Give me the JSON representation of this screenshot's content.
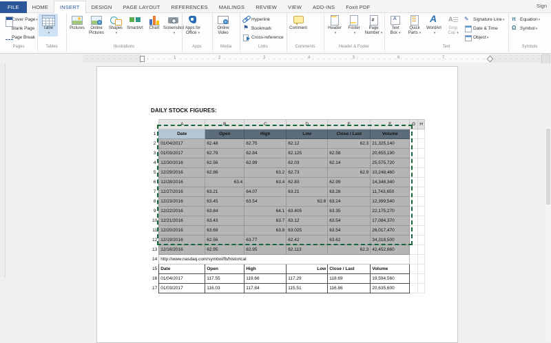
{
  "ribbon": {
    "tabs": [
      "FILE",
      "HOME",
      "INSERT",
      "DESIGN",
      "PAGE LAYOUT",
      "REFERENCES",
      "MAILINGS",
      "REVIEW",
      "VIEW",
      "ADD-INS",
      "Foxit PDF"
    ],
    "active_tab": "INSERT",
    "sign_label": "Sign",
    "groups": [
      {
        "label": "Pages",
        "items": [
          {
            "l1": "Cover Page",
            "arrow": true,
            "icon": "cover-page-icon",
            "small": true
          },
          {
            "l1": "Blank Page",
            "icon": "blank-page-icon",
            "small": true
          },
          {
            "l1": "Page Break",
            "icon": "page-break-icon",
            "small": true
          }
        ]
      },
      {
        "label": "Tables",
        "items": [
          {
            "l1": "Table",
            "arrow": true,
            "icon": "table-icon",
            "highlight": true
          }
        ]
      },
      {
        "label": "Illustrations",
        "items": [
          {
            "l1": "Pictures",
            "icon": "pictures-icon"
          },
          {
            "l1": "Online",
            "l2": "Pictures",
            "icon": "online-pictures-icon"
          },
          {
            "l1": "Shapes",
            "arrow": true,
            "icon": "shapes-icon"
          },
          {
            "l1": "SmartArt",
            "icon": "smartart-icon"
          },
          {
            "l1": "Chart",
            "icon": "chart-icon"
          },
          {
            "l1": "Screenshot",
            "arrow": true,
            "icon": "screenshot-icon"
          }
        ]
      },
      {
        "label": "Apps",
        "items": [
          {
            "l1": "Apps for",
            "l2": "Office",
            "arrow": true,
            "icon": "apps-for-office-icon"
          }
        ]
      },
      {
        "label": "Media",
        "items": [
          {
            "l1": "Online",
            "l2": "Video",
            "icon": "online-video-icon"
          }
        ]
      },
      {
        "label": "Links",
        "items": [
          {
            "l1": "Hyperlink",
            "icon": "hyperlink-icon",
            "small": true
          },
          {
            "l1": "Bookmark",
            "icon": "bookmark-icon",
            "small": true
          },
          {
            "l1": "Cross-reference",
            "icon": "cross-reference-icon",
            "small": true
          }
        ]
      },
      {
        "label": "Comments",
        "items": [
          {
            "l1": "Comment",
            "icon": "comment-icon"
          }
        ]
      },
      {
        "label": "Header & Footer",
        "items": [
          {
            "l1": "Header",
            "arrow": true,
            "icon": "header-icon"
          },
          {
            "l1": "Footer",
            "arrow": true,
            "icon": "footer-icon"
          },
          {
            "l1": "Page",
            "l2": "Number",
            "arrow": true,
            "icon": "page-number-icon"
          }
        ]
      },
      {
        "label": "Text",
        "items": [
          {
            "l1": "Text",
            "l2": "Box",
            "arrow": true,
            "icon": "text-box-icon"
          },
          {
            "l1": "Quick",
            "l2": "Parts",
            "arrow": true,
            "icon": "quick-parts-icon"
          },
          {
            "l1": "WordArt",
            "arrow": true,
            "icon": "wordart-icon"
          },
          {
            "l1": "Drop",
            "l2": "Cap",
            "arrow": true,
            "icon": "drop-cap-icon",
            "disabled": true
          },
          {
            "l1": "Signature Line",
            "arrow": true,
            "icon": "signature-line-icon",
            "small": true
          },
          {
            "l1": "Date & Time",
            "icon": "date-time-icon",
            "small": true
          },
          {
            "l1": "Object",
            "arrow": true,
            "icon": "object-icon",
            "small": true
          }
        ]
      },
      {
        "label": "Symbols",
        "items": [
          {
            "l1": "Equation",
            "arrow": true,
            "icon": "equation-icon",
            "small": true
          },
          {
            "l1": "Symbol",
            "arrow": true,
            "icon": "symbol-icon",
            "small": true
          }
        ]
      }
    ]
  },
  "ruler": {
    "numbers": [
      "1",
      "2",
      "3",
      "4",
      "5",
      "6",
      "7"
    ]
  },
  "colors": {
    "accent": "#2b579a",
    "selection_dash": "#17663a",
    "sheet_header_fill": "#5d6c7b",
    "active_cell_fill": "#b4c6d4",
    "selected_cell_fill": "#b5b5b5"
  },
  "document": {
    "title": "DAILY STOCK FIGURES:",
    "spreadsheet": {
      "column_letters": [
        "A",
        "B",
        "C",
        "D",
        "E",
        "F",
        "G",
        "H"
      ],
      "rows": [
        {
          "n": "1",
          "type": "h1",
          "cells": [
            "Date",
            "Open",
            "High",
            "Low",
            "Close / Last",
            "Volume"
          ]
        },
        {
          "n": "2",
          "type": "sel",
          "cells": [
            [
              "01/04/2017"
            ],
            [
              "62.48"
            ],
            [
              "62.75"
            ],
            [
              "62.12"
            ],
            [
              "62.3",
              "r"
            ],
            [
              "21,325,140"
            ]
          ]
        },
        {
          "n": "3",
          "type": "sel",
          "cells": [
            [
              "01/03/2017"
            ],
            [
              "62.79"
            ],
            [
              "62.84"
            ],
            [
              "62.125"
            ],
            [
              "62.58"
            ],
            [
              "20,655,190"
            ]
          ]
        },
        {
          "n": "4",
          "type": "sel",
          "cells": [
            [
              "12/30/2016"
            ],
            [
              "62.56"
            ],
            [
              "62.99"
            ],
            [
              "62.03"
            ],
            [
              "62.14"
            ],
            [
              "25,575,720"
            ]
          ]
        },
        {
          "n": "5",
          "type": "sel",
          "cells": [
            [
              "12/29/2016"
            ],
            [
              "62.86"
            ],
            [
              "63.2",
              "r"
            ],
            [
              "62.73"
            ],
            [
              "62.9",
              "r"
            ],
            [
              "10,248,460"
            ]
          ]
        },
        {
          "n": "6",
          "type": "sel",
          "cells": [
            [
              "12/28/2016"
            ],
            [
              "63.4",
              "r"
            ],
            [
              "63.4",
              "r"
            ],
            [
              "62.83"
            ],
            [
              "62.99"
            ],
            [
              "14,348,340"
            ]
          ]
        },
        {
          "n": "7",
          "type": "sel",
          "cells": [
            [
              "12/27/2016"
            ],
            [
              "63.21"
            ],
            [
              "64.07"
            ],
            [
              "63.21"
            ],
            [
              "63.28"
            ],
            [
              "11,743,650"
            ]
          ]
        },
        {
          "n": "8",
          "type": "sel",
          "cells": [
            [
              "12/23/2016"
            ],
            [
              "63.45"
            ],
            [
              "63.54"
            ],
            [
              "62.8",
              "r"
            ],
            [
              "63.24"
            ],
            [
              "12,399,540"
            ]
          ]
        },
        {
          "n": "9",
          "type": "sel",
          "cells": [
            [
              "12/22/2016"
            ],
            [
              "63.84"
            ],
            [
              "64.1",
              "r"
            ],
            [
              "63.405"
            ],
            [
              "63.35"
            ],
            [
              "22,175,270"
            ]
          ]
        },
        {
          "n": "10",
          "type": "sel",
          "cells": [
            [
              "12/21/2016"
            ],
            [
              "63.43"
            ],
            [
              "63.7",
              "r"
            ],
            [
              "63.12"
            ],
            [
              "63.54"
            ],
            [
              "17,084,370"
            ]
          ]
        },
        {
          "n": "11",
          "type": "sel",
          "cells": [
            [
              "12/20/2016"
            ],
            [
              "63.69"
            ],
            [
              "63.8",
              "r"
            ],
            [
              "63.025"
            ],
            [
              "63.54"
            ],
            [
              "26,017,470"
            ]
          ]
        },
        {
          "n": "12",
          "type": "sel",
          "cells": [
            [
              "12/19/2016"
            ],
            [
              "62.56"
            ],
            [
              "63.77"
            ],
            [
              "62.42"
            ],
            [
              "63.62"
            ],
            [
              "34,318,500"
            ]
          ]
        },
        {
          "n": "13",
          "type": "sel",
          "cells": [
            [
              "12/16/2016"
            ],
            [
              "62.95"
            ],
            [
              "62.95"
            ],
            [
              "62.113"
            ],
            [
              "62.3",
              "r"
            ],
            [
              "42,452,660"
            ]
          ]
        },
        {
          "n": "14",
          "type": "url",
          "text": "http://www.nasdaq.com/symbol/fb/historical"
        },
        {
          "n": "15",
          "type": "h2",
          "cells": [
            [
              "Date"
            ],
            [
              "Open"
            ],
            [
              "High"
            ],
            [
              "Low",
              "r"
            ],
            [
              "Close / Last"
            ],
            [
              "Volume"
            ]
          ]
        },
        {
          "n": "16",
          "type": "plain",
          "cells": [
            [
              "01/04/2017"
            ],
            [
              "117.55"
            ],
            [
              "119.66"
            ],
            [
              "117.29"
            ],
            [
              "118.69"
            ],
            [
              "19,594,560"
            ]
          ]
        },
        {
          "n": "17",
          "type": "plain",
          "cells": [
            [
              "01/03/2017"
            ],
            [
              "116.03"
            ],
            [
              "117.84"
            ],
            [
              "115.51"
            ],
            [
              "116.86"
            ],
            [
              "20,635,600"
            ]
          ]
        }
      ]
    }
  }
}
